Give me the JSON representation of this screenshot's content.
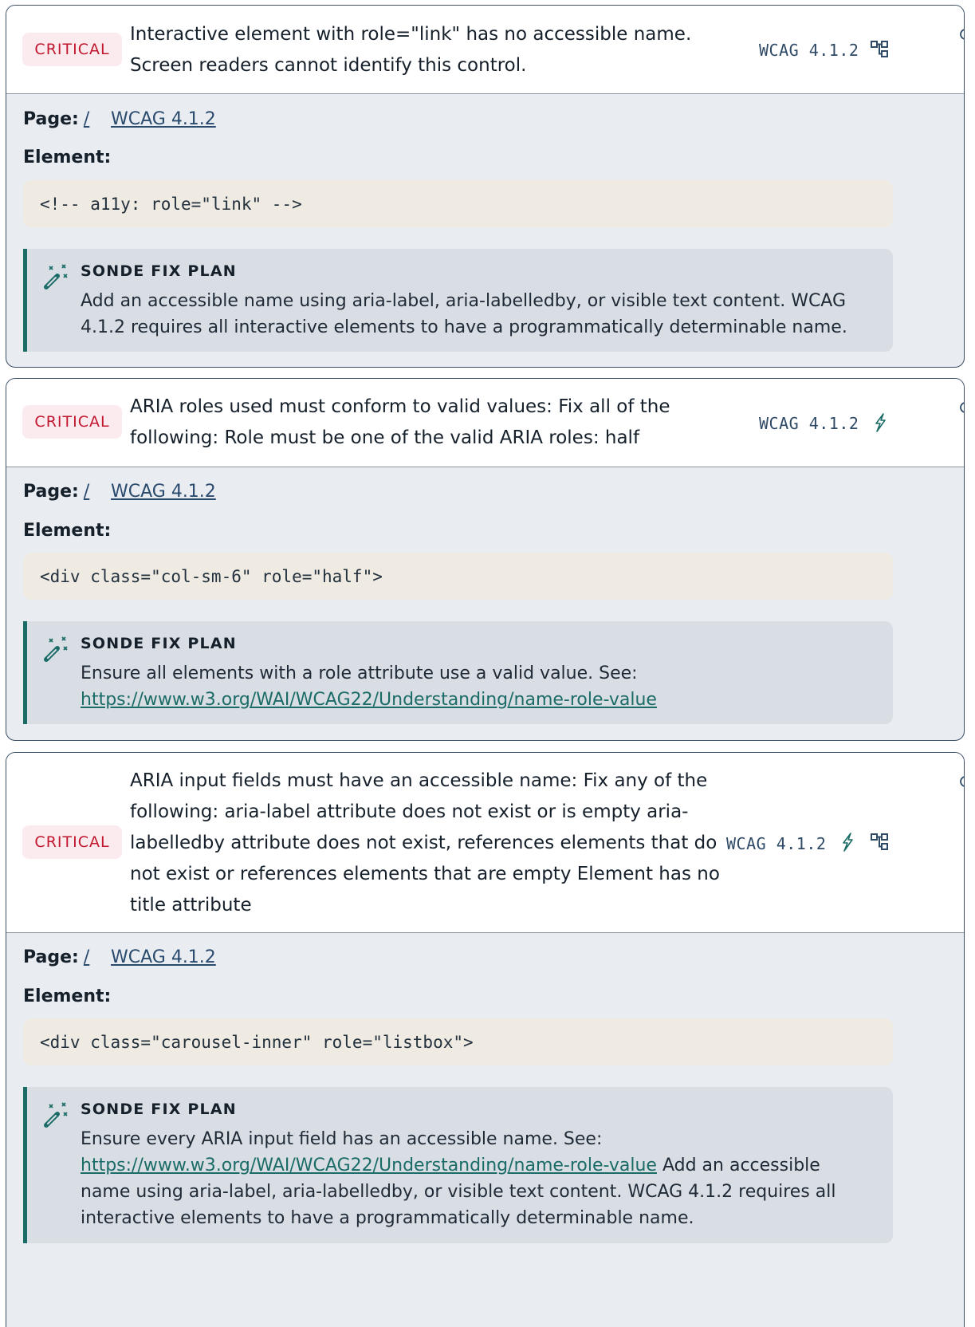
{
  "issues": [
    {
      "severity": "CRITICAL",
      "summary": "Interactive element with role=\"link\" has no accessible name. Screen readers cannot identify this control.",
      "wcag_tag": "WCAG 4.1.2",
      "icons": [
        "tree-icon"
      ],
      "page_label": "Page:",
      "page_link": "/",
      "wcag_link": "WCAG 4.1.2",
      "element_label": "Element:",
      "code": "<!-- a11y: role=\"link\" -->",
      "fix_title": "SONDE FIX PLAN",
      "fix_text": "Add an accessible name using aria-label, aria-labelledby, or visible text content. WCAG 4.1.2 requires all interactive elements to have a programmatically determinable name.",
      "fix_link": "",
      "fix_text_after": ""
    },
    {
      "severity": "CRITICAL",
      "summary": "ARIA roles used must conform to valid values: Fix all of the following: Role must be one of the valid ARIA roles: half",
      "wcag_tag": "WCAG 4.1.2",
      "icons": [
        "bolt-icon"
      ],
      "page_label": "Page:",
      "page_link": "/",
      "wcag_link": "WCAG 4.1.2",
      "element_label": "Element:",
      "code": "<div class=\"col-sm-6\" role=\"half\">",
      "fix_title": "SONDE FIX PLAN",
      "fix_text": "Ensure all elements with a role attribute use a valid value. See:",
      "fix_link": "https://www.w3.org/WAI/WCAG22/Understanding/name-role-value",
      "fix_text_after": ""
    },
    {
      "severity": "CRITICAL",
      "summary": "ARIA input fields must have an accessible name: Fix any of the following: aria-label attribute does not exist or is empty aria-labelledby attribute does not exist, references elements that do not exist or references elements that are empty Element has no title attribute",
      "wcag_tag": "WCAG 4.1.2",
      "icons": [
        "bolt-icon",
        "tree-icon"
      ],
      "page_label": "Page:",
      "page_link": "/",
      "wcag_link": "WCAG 4.1.2",
      "element_label": "Element:",
      "code": "<div class=\"carousel-inner\" role=\"listbox\">",
      "fix_title": "SONDE FIX PLAN",
      "fix_text": "Ensure every ARIA input field has an accessible name. See:",
      "fix_link": "https://www.w3.org/WAI/WCAG22/Understanding/name-role-value",
      "fix_text_after": " Add an accessible name using aria-label, aria-labelledby, or visible text content. WCAG 4.1.2 requires all interactive elements to have a programmatically determinable name."
    }
  ],
  "colors": {
    "critical_text": "#c0172f",
    "critical_bg": "#fcebee",
    "accent_teal": "#1b6b67",
    "link_blue": "#2b4b6e"
  }
}
